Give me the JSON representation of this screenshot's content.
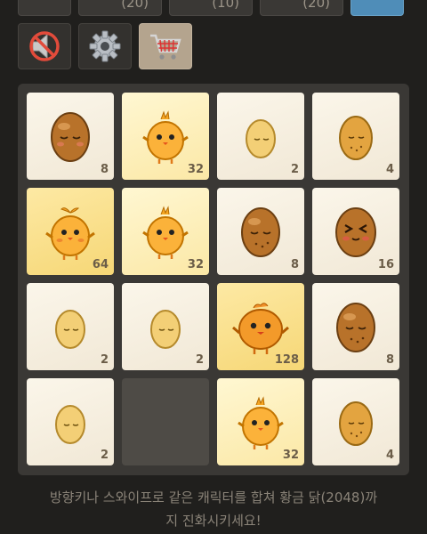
{
  "top_buttons": [
    {
      "name": "top-button-1",
      "count": ""
    },
    {
      "name": "top-button-2",
      "count": "(20)"
    },
    {
      "name": "top-button-3",
      "count": "(10)"
    },
    {
      "name": "top-button-4",
      "count": "(20)"
    },
    {
      "name": "top-button-5",
      "count": ""
    }
  ],
  "tools": [
    {
      "name": "mute-button",
      "icon": "speaker-muted-icon"
    },
    {
      "name": "settings-button",
      "icon": "gear-icon"
    },
    {
      "name": "shop-button",
      "icon": "shopping-cart-icon"
    }
  ],
  "board": {
    "tiles": [
      {
        "value": "8",
        "kind": "brown-egg"
      },
      {
        "value": "32",
        "kind": "chick"
      },
      {
        "value": "2",
        "kind": "small-egg"
      },
      {
        "value": "4",
        "kind": "egg"
      },
      {
        "value": "64",
        "kind": "chick-sprout"
      },
      {
        "value": "32",
        "kind": "chick"
      },
      {
        "value": "8",
        "kind": "brown-egg"
      },
      {
        "value": "16",
        "kind": "angry-egg"
      },
      {
        "value": "2",
        "kind": "small-egg"
      },
      {
        "value": "2",
        "kind": "small-egg"
      },
      {
        "value": "128",
        "kind": "round-chick"
      },
      {
        "value": "8",
        "kind": "brown-egg"
      },
      {
        "value": "2",
        "kind": "small-egg"
      },
      {
        "value": "",
        "kind": "empty"
      },
      {
        "value": "32",
        "kind": "chick"
      },
      {
        "value": "4",
        "kind": "egg"
      }
    ]
  },
  "hint_line1": "방향키나 스와이프로 같은 캐릭터를 합쳐 황금 닭(2048)까",
  "hint_line2": "지 진화시키세요!"
}
